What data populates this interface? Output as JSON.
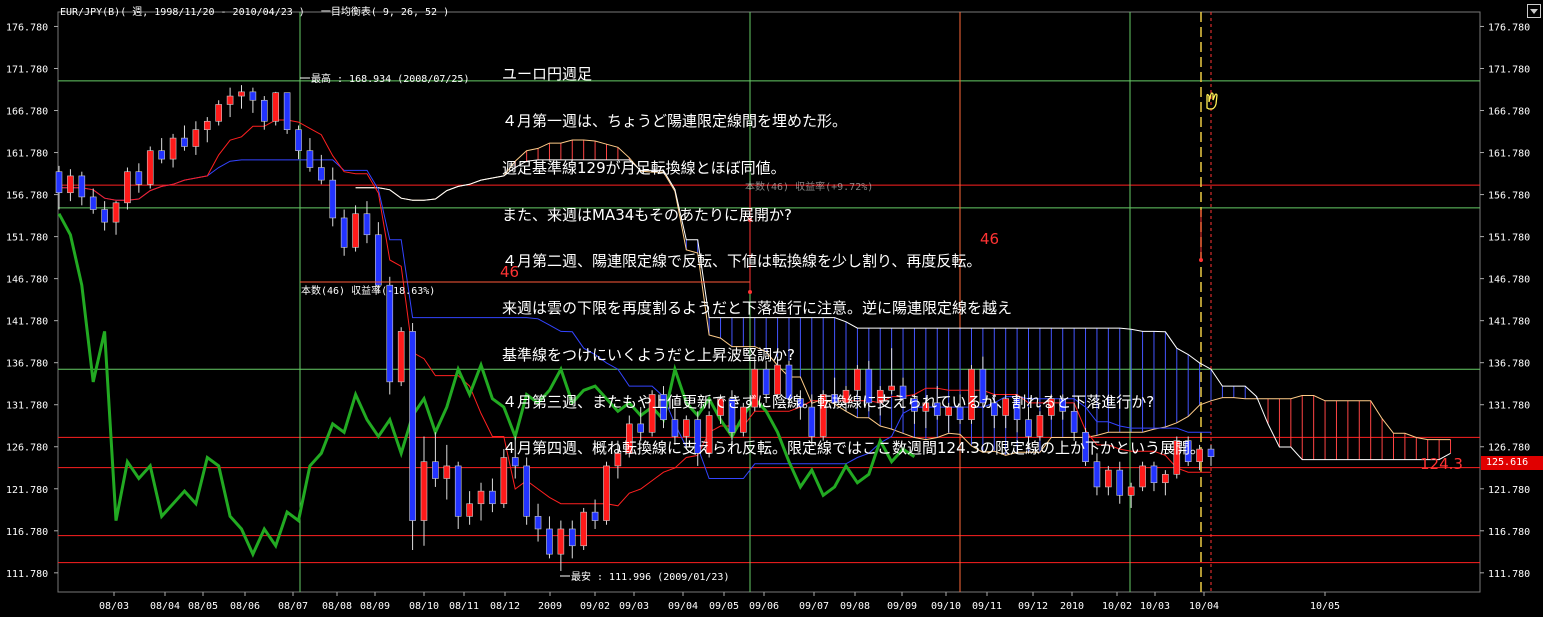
{
  "window": {
    "title": "EUR/JPY(B)( 週, 1998/11/20 - 2010/04/23 )　 一目均衡表( 9, 26, 52 )"
  },
  "note_lines": [
    "ユーロ円週足",
    "４月第一週は、ちょうど陽連限定線間を埋めた形。",
    "週足基準線129が月足転換線とほぼ同値。",
    "また、来週はMA34もそのあたりに展開か?",
    "４月第二週、陽連限定線で反転、下値は転換線を少し割り、再度反転。",
    "来週は雲の下限を再度割るようだと下落進行に注意。逆に陽連限定線を越え",
    "基準線をつけにいくようだと上昇波堅調か?",
    "４月第三週、またもや上値更新できずに陰線。転換線に支えられているが、割れると下落進行か?",
    "４月第四週、概ね転換線に支えられ反転。限定線ではここ数週間124.3の限定線の上か下かという展開。"
  ],
  "annotations": {
    "high_label": "最高 : 168.934 (2008/07/25)",
    "low_label": "最安 : 111.996 (2009/01/23)",
    "count_label": "本数(46) 収益率(-18.63%)",
    "count_46_a": "46",
    "count_46_b": "46",
    "level_label": "124.3",
    "overlap_label": "本数(46) 収益率(+9.72%)"
  },
  "current_price": "125.616",
  "colors": {
    "background": "#000000",
    "up_candle": "#ff1a1a",
    "down_candle": "#2233ff",
    "tenkan": "#ff2020",
    "kijun": "#3344ff",
    "chikou": "#22aa22",
    "kumo_bull": "#ff4444",
    "kumo_bear": "#4455ff",
    "hline_red": "#ff2020",
    "hline_green": "#66cc66"
  },
  "chart_data": {
    "type": "candlestick",
    "instrument": "EUR/JPY(B)",
    "ylim": [
      109.5,
      178.5
    ],
    "y_ticks": [
      176.78,
      171.78,
      166.78,
      161.78,
      156.78,
      151.78,
      146.78,
      141.78,
      136.78,
      131.78,
      126.78,
      121.78,
      116.78,
      111.78
    ],
    "x_labels": [
      "08/03",
      "08/04",
      "08/05",
      "08/06",
      "08/07",
      "08/08",
      "08/09",
      "08/10",
      "08/11",
      "08/12",
      "2009",
      "09/02",
      "09/03",
      "09/04",
      "09/05",
      "09/06",
      "09/07",
      "09/08",
      "09/09",
      "09/10",
      "09/11",
      "09/12",
      "2010",
      "10/02",
      "10/03",
      "10/04",
      "10/05"
    ],
    "horizontal_lines": {
      "red": [
        157.9,
        127.9,
        124.3,
        116.2,
        113.0
      ],
      "green": [
        170.3,
        155.2,
        136.0
      ]
    },
    "candles_ohlc": [
      [
        159.5,
        160.2,
        155.0,
        157.0
      ],
      [
        157.0,
        159.8,
        156.0,
        159.0
      ],
      [
        159.0,
        159.5,
        155.5,
        156.5
      ],
      [
        156.5,
        157.5,
        154.5,
        155.0
      ],
      [
        155.0,
        156.0,
        152.5,
        153.5
      ],
      [
        153.5,
        156.0,
        152.0,
        155.8
      ],
      [
        155.8,
        160.0,
        155.0,
        159.5
      ],
      [
        159.5,
        160.5,
        157.0,
        158.0
      ],
      [
        158.0,
        162.5,
        157.5,
        162.0
      ],
      [
        162.0,
        163.5,
        160.5,
        161.0
      ],
      [
        161.0,
        164.0,
        160.0,
        163.5
      ],
      [
        163.5,
        165.0,
        162.0,
        162.5
      ],
      [
        162.5,
        165.5,
        161.5,
        164.5
      ],
      [
        164.5,
        166.0,
        163.0,
        165.5
      ],
      [
        165.5,
        168.0,
        165.0,
        167.5
      ],
      [
        167.5,
        169.5,
        166.0,
        168.5
      ],
      [
        168.5,
        169.8,
        167.0,
        169.0
      ],
      [
        169.0,
        169.5,
        166.5,
        168.0
      ],
      [
        168.0,
        168.5,
        164.5,
        165.5
      ],
      [
        165.5,
        169.0,
        165.0,
        168.9
      ],
      [
        168.9,
        168.9,
        164.0,
        164.5
      ],
      [
        164.5,
        165.0,
        161.0,
        162.0
      ],
      [
        162.0,
        163.5,
        159.5,
        160.0
      ],
      [
        160.0,
        161.5,
        158.0,
        158.5
      ],
      [
        158.5,
        160.0,
        153.0,
        154.0
      ],
      [
        154.0,
        155.0,
        149.5,
        150.5
      ],
      [
        150.5,
        155.5,
        150.0,
        154.5
      ],
      [
        154.5,
        156.0,
        151.0,
        152.0
      ],
      [
        152.0,
        153.5,
        145.0,
        146.0
      ],
      [
        146.0,
        147.0,
        133.0,
        134.5
      ],
      [
        134.5,
        141.0,
        134.0,
        140.5
      ],
      [
        140.5,
        141.5,
        114.5,
        118.0
      ],
      [
        118.0,
        128.0,
        115.0,
        125.0
      ],
      [
        125.0,
        128.5,
        122.0,
        123.0
      ],
      [
        123.0,
        127.0,
        120.5,
        124.5
      ],
      [
        124.5,
        125.0,
        117.0,
        118.5
      ],
      [
        118.5,
        121.5,
        117.5,
        120.0
      ],
      [
        120.0,
        122.5,
        118.0,
        121.5
      ],
      [
        121.5,
        123.0,
        119.0,
        120.0
      ],
      [
        120.0,
        126.5,
        119.5,
        125.5
      ],
      [
        125.5,
        128.0,
        123.0,
        124.5
      ],
      [
        124.5,
        125.5,
        117.5,
        118.5
      ],
      [
        118.5,
        120.0,
        115.5,
        117.0
      ],
      [
        117.0,
        118.5,
        113.5,
        114.0
      ],
      [
        114.0,
        118.0,
        112.0,
        117.0
      ],
      [
        117.0,
        118.0,
        113.5,
        115.0
      ],
      [
        115.0,
        119.5,
        114.5,
        119.0
      ],
      [
        119.0,
        120.5,
        117.0,
        118.0
      ],
      [
        118.0,
        125.0,
        117.5,
        124.5
      ],
      [
        124.5,
        127.5,
        123.0,
        126.0
      ],
      [
        126.0,
        130.5,
        125.5,
        129.5
      ],
      [
        129.5,
        131.5,
        127.5,
        128.5
      ],
      [
        128.5,
        133.5,
        128.0,
        133.0
      ],
      [
        133.0,
        134.0,
        129.0,
        130.0
      ],
      [
        130.0,
        131.5,
        127.0,
        128.0
      ],
      [
        128.0,
        130.5,
        126.5,
        130.0
      ],
      [
        130.0,
        131.0,
        124.5,
        126.0
      ],
      [
        126.0,
        131.0,
        125.5,
        130.5
      ],
      [
        130.5,
        133.0,
        129.5,
        132.5
      ],
      [
        132.5,
        133.5,
        127.5,
        128.5
      ],
      [
        128.5,
        132.0,
        128.0,
        131.5
      ],
      [
        131.5,
        137.5,
        131.0,
        136.0
      ],
      [
        136.0,
        137.0,
        132.0,
        133.0
      ],
      [
        133.0,
        137.5,
        132.5,
        136.5
      ],
      [
        136.5,
        137.0,
        131.5,
        132.5
      ],
      [
        132.5,
        133.5,
        130.0,
        131.5
      ],
      [
        131.5,
        133.0,
        127.0,
        128.0
      ],
      [
        128.0,
        133.5,
        127.5,
        133.0
      ],
      [
        133.0,
        135.0,
        131.5,
        132.0
      ],
      [
        132.0,
        134.0,
        131.0,
        133.5
      ],
      [
        133.5,
        136.5,
        133.0,
        136.0
      ],
      [
        136.0,
        137.0,
        131.0,
        132.0
      ],
      [
        132.0,
        134.0,
        130.5,
        133.5
      ],
      [
        133.5,
        138.5,
        133.0,
        134.0
      ],
      [
        134.0,
        135.0,
        131.5,
        132.5
      ],
      [
        132.5,
        133.0,
        129.5,
        131.0
      ],
      [
        131.0,
        132.5,
        129.0,
        132.0
      ],
      [
        132.0,
        134.0,
        130.0,
        130.5
      ],
      [
        130.5,
        132.0,
        128.5,
        131.5
      ],
      [
        131.5,
        133.0,
        129.5,
        130.0
      ],
      [
        130.0,
        136.5,
        129.5,
        136.0
      ],
      [
        136.0,
        137.5,
        131.5,
        132.0
      ],
      [
        132.0,
        133.0,
        129.0,
        130.5
      ],
      [
        130.5,
        133.0,
        129.0,
        132.5
      ],
      [
        132.5,
        133.0,
        128.5,
        130.0
      ],
      [
        130.0,
        131.5,
        126.5,
        128.0
      ],
      [
        128.0,
        131.0,
        127.5,
        130.5
      ],
      [
        130.5,
        133.0,
        130.0,
        132.5
      ],
      [
        132.5,
        133.0,
        130.0,
        131.0
      ],
      [
        131.0,
        132.0,
        127.5,
        128.5
      ],
      [
        128.5,
        129.0,
        124.5,
        125.0
      ],
      [
        125.0,
        126.0,
        121.0,
        122.0
      ],
      [
        122.0,
        124.5,
        121.0,
        124.0
      ],
      [
        124.0,
        125.0,
        120.0,
        121.0
      ],
      [
        121.0,
        122.5,
        119.5,
        122.0
      ],
      [
        122.0,
        125.0,
        121.5,
        124.5
      ],
      [
        124.5,
        125.0,
        121.5,
        122.5
      ],
      [
        122.5,
        124.0,
        121.0,
        123.5
      ],
      [
        123.5,
        128.0,
        123.0,
        127.5
      ],
      [
        127.5,
        128.0,
        124.5,
        125.0
      ],
      [
        125.0,
        127.0,
        124.0,
        126.5
      ],
      [
        126.5,
        127.0,
        124.5,
        125.6
      ]
    ]
  }
}
